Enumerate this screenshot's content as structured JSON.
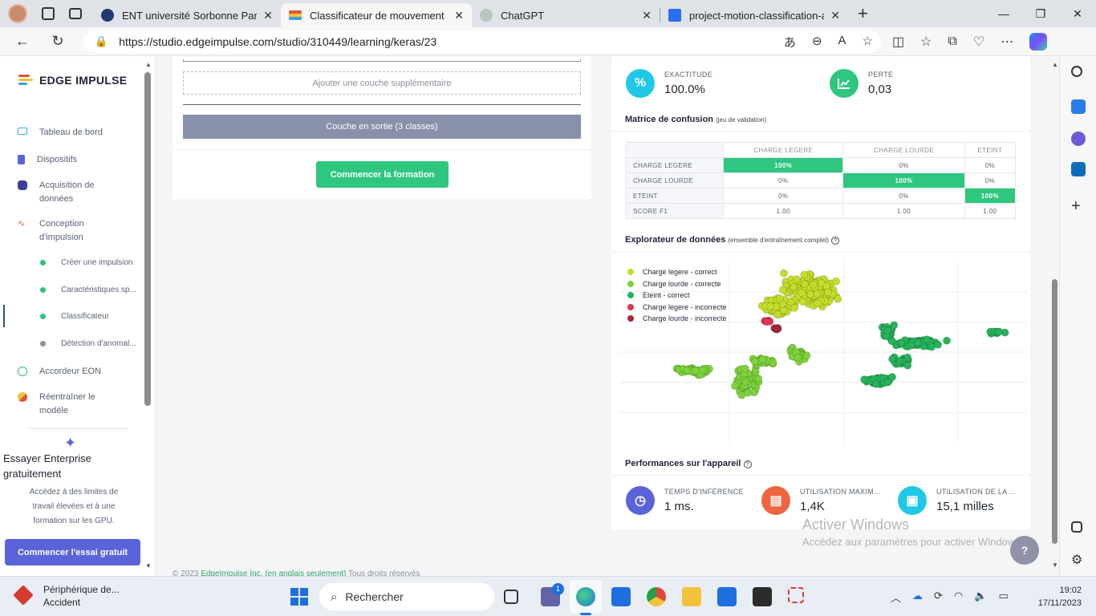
{
  "browser": {
    "tabs": [
      {
        "label": "ENT université Sorbonne Paris No",
        "fav_color": "#1f3a6b",
        "active": false
      },
      {
        "label": "Classificateur de mouvement ind",
        "fav_color": "#e0553a",
        "active": true
      },
      {
        "label": "ChatGPT",
        "fav_color": "#b9c5bf",
        "active": false
      },
      {
        "label": "project-motion-classification-and",
        "fav_color": "#2b6df0",
        "active": false
      }
    ],
    "url": "https://studio.edgeimpulse.com/studio/310449/learning/keras/23"
  },
  "nav": {
    "logo": "EDGE IMPULSE",
    "items": [
      {
        "label": "Tableau de bord",
        "icon": "monitor-icon"
      },
      {
        "label": "Dispositifs",
        "icon": "chip-icon"
      },
      {
        "label": "Acquisition de données",
        "icon": "database-icon"
      },
      {
        "label": "Conception d'impulsion",
        "icon": "pulse-icon"
      }
    ],
    "sub_items": [
      {
        "label": "Créer une impulsion",
        "dot": "#28c76f"
      },
      {
        "label": "Caractéristiques sp...",
        "dot": "#28c76f"
      },
      {
        "label": "Classificateur",
        "dot": "#28c76f"
      },
      {
        "label": "Détection d'anomal...",
        "dot": "#8a93a6"
      }
    ],
    "items2": [
      {
        "label": "Accordeur EON",
        "icon": "eon-icon"
      },
      {
        "label": "Réentraîner le modèle",
        "icon": "retrain-icon"
      }
    ],
    "enterprise": {
      "title": "Essayer Enterprise gratuitement",
      "desc": "Accédez à des limites de travail élevées et à une formation sur les GPU.",
      "button": "Commencer l'essai gratuit"
    }
  },
  "builder": {
    "add_layer": "Ajouter une couche supplémentaire",
    "output_layer": "Couche en sortie (3 classes)",
    "start_button": "Commencer la formation",
    "footer": "© 2023",
    "footer_link": "EdgeImpulse Inc. (en anglais seulement)",
    "footer_rest": "Tous droits réservés"
  },
  "results": {
    "accuracy_label": "EXACTITUDE",
    "accuracy_value": "100.0%",
    "loss_label": "PERTE",
    "loss_value": "0,03",
    "confusion_title": "Matrice de confusion",
    "confusion_sub": "(jeu de validation)",
    "confusion": {
      "columns": [
        "CHARGE LEGERE",
        "CHARGE LOURDE",
        "ETEINT"
      ],
      "rows": [
        {
          "label": "CHARGE LEGERE",
          "cells": [
            "100%",
            "0%",
            "0%"
          ]
        },
        {
          "label": "CHARGE LOURDE",
          "cells": [
            "0%",
            "100%",
            "0%"
          ]
        },
        {
          "label": "ETEINT",
          "cells": [
            "0%",
            "0%",
            "100%"
          ]
        },
        {
          "label": "SCORE F1",
          "cells": [
            "1.00",
            "1.00",
            "1.00"
          ]
        }
      ]
    },
    "explorer_title": "Explorateur de données",
    "explorer_sub": "(ensemble d'entraînement complet)",
    "perf_title": "Performances sur l'appareil",
    "perf": [
      {
        "label": "TEMPS D'INFÉRENCE",
        "value": "1 ms.",
        "color": "#5b63d9"
      },
      {
        "label": "UTILISATION MAXIM...",
        "value": "1,4K",
        "color": "#f0653f"
      },
      {
        "label": "UTILISATION DE LA ...",
        "value": "15,1 milles",
        "color": "#1ec8e6"
      }
    ]
  },
  "chart_data": {
    "type": "scatter",
    "title": "",
    "xlabel": "",
    "ylabel": "",
    "grid": true,
    "legend_position": "top-left",
    "series": [
      {
        "name": "Charge legere - correct",
        "color": "#c5dc2a",
        "clusters": [
          [
            0.47,
            0.16,
            0.08,
            0.11,
            190
          ],
          [
            0.39,
            0.25,
            0.05,
            0.07,
            55
          ]
        ]
      },
      {
        "name": "Charge lourde - correcte",
        "color": "#7dd33a",
        "clusters": [
          [
            0.18,
            0.6,
            0.07,
            0.03,
            40
          ],
          [
            0.31,
            0.66,
            0.04,
            0.1,
            75
          ],
          [
            0.44,
            0.51,
            0.03,
            0.05,
            30
          ],
          [
            0.35,
            0.55,
            0.05,
            0.03,
            25
          ]
        ]
      },
      {
        "name": "Eteint - correct",
        "color": "#26b35a",
        "clusters": [
          [
            0.66,
            0.38,
            0.02,
            0.06,
            25
          ],
          [
            0.73,
            0.45,
            0.08,
            0.03,
            60
          ],
          [
            0.64,
            0.66,
            0.05,
            0.03,
            45
          ],
          [
            0.69,
            0.55,
            0.03,
            0.03,
            25
          ],
          [
            0.92,
            0.39,
            0.03,
            0.01,
            10
          ]
        ]
      },
      {
        "name": "Charge legere - incorrecte",
        "color": "#e03452",
        "clusters": [
          [
            0.36,
            0.33,
            0.02,
            0.01,
            5
          ]
        ]
      },
      {
        "name": "Charge lourde - incorrecte",
        "color": "#a8253f",
        "clusters": [
          [
            0.39,
            0.37,
            0.015,
            0.01,
            5
          ]
        ]
      }
    ]
  },
  "watermark": {
    "line1": "Activer Windows",
    "line2": "Accédez aux paramètres pour activer Windows."
  },
  "taskbar": {
    "notif_title": "Périphérique de...",
    "notif_sub": "Accident",
    "search": "Rechercher",
    "badge": "1",
    "time": "19:02",
    "date": "17/11/2023"
  }
}
